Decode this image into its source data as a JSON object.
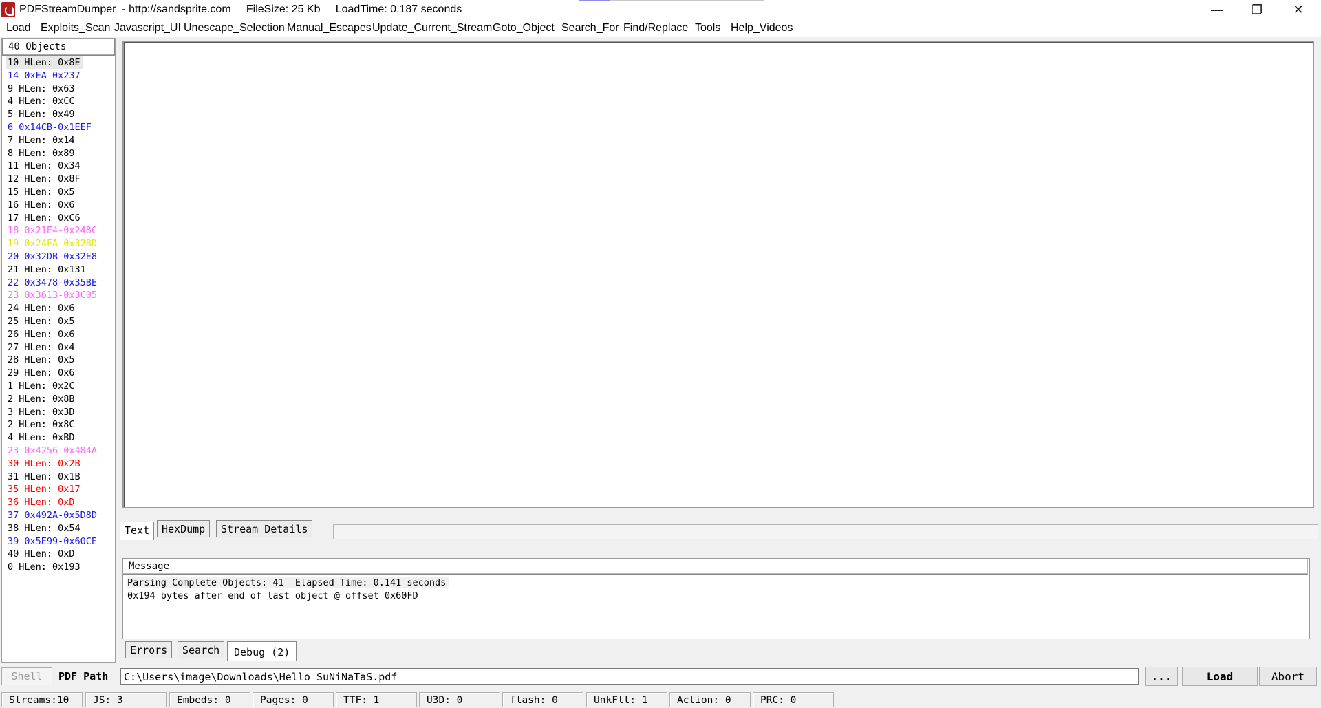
{
  "window": {
    "title": "PDFStreamDumper  - http://sandsprite.com     FileSize: 25 Kb     LoadTime: 0.187 seconds",
    "minimize_glyph": "—",
    "maximize_glyph": "❐",
    "close_glyph": "✕"
  },
  "menu": [
    "Load",
    "Exploits_Scan",
    "Javascript_UI",
    "Unescape_Selection",
    "Manual_Escapes",
    "Update_Current_Stream",
    "Goto_Object",
    "Search_For",
    "Find/Replace",
    "Tools",
    "Help_Videos"
  ],
  "objects": {
    "header": "40 Objects",
    "items": [
      {
        "text": "10 HLen: 0x8E",
        "color": "#000000"
      },
      {
        "text": "14 0xEA-0x237",
        "color": "#1a1ae6"
      },
      {
        "text": "9 HLen: 0x63",
        "color": "#000000"
      },
      {
        "text": "4 HLen: 0xCC",
        "color": "#000000"
      },
      {
        "text": "5 HLen: 0x49",
        "color": "#000000"
      },
      {
        "text": "6 0x14CB-0x1EEF",
        "color": "#1a1ae6"
      },
      {
        "text": "7 HLen: 0x14",
        "color": "#000000"
      },
      {
        "text": "8 HLen: 0x89",
        "color": "#000000"
      },
      {
        "text": "11 HLen: 0x34",
        "color": "#000000"
      },
      {
        "text": "12 HLen: 0x8F",
        "color": "#000000"
      },
      {
        "text": "15 HLen: 0x5",
        "color": "#000000"
      },
      {
        "text": "16 HLen: 0x6",
        "color": "#000000"
      },
      {
        "text": "17 HLen: 0xC6",
        "color": "#000000"
      },
      {
        "text": "18 0x21E4-0x248C",
        "color": "#ff66ff"
      },
      {
        "text": "19 0x24FA-0x328D",
        "color": "#e6e600"
      },
      {
        "text": "20 0x32DB-0x32E8",
        "color": "#1a1ae6"
      },
      {
        "text": "21 HLen: 0x131",
        "color": "#000000"
      },
      {
        "text": "22 0x3478-0x35BE",
        "color": "#1a1ae6"
      },
      {
        "text": "23 0x3613-0x3C05",
        "color": "#ff66ff"
      },
      {
        "text": "24 HLen: 0x6",
        "color": "#000000"
      },
      {
        "text": "25 HLen: 0x5",
        "color": "#000000"
      },
      {
        "text": "26 HLen: 0x6",
        "color": "#000000"
      },
      {
        "text": "27 HLen: 0x4",
        "color": "#000000"
      },
      {
        "text": "28 HLen: 0x5",
        "color": "#000000"
      },
      {
        "text": "29 HLen: 0x6",
        "color": "#000000"
      },
      {
        "text": "1 HLen: 0x2C",
        "color": "#000000"
      },
      {
        "text": "2 HLen: 0x8B",
        "color": "#000000"
      },
      {
        "text": "3 HLen: 0x3D",
        "color": "#000000"
      },
      {
        "text": "2 HLen: 0x8C",
        "color": "#000000"
      },
      {
        "text": "4 HLen: 0xBD",
        "color": "#000000"
      },
      {
        "text": "23 0x4256-0x484A",
        "color": "#ff66ff"
      },
      {
        "text": "30 HLen: 0x2B",
        "color": "#ff0000"
      },
      {
        "text": "31 HLen: 0x1B",
        "color": "#000000"
      },
      {
        "text": "35 HLen: 0x17",
        "color": "#ff0000"
      },
      {
        "text": "36 HLen: 0xD",
        "color": "#ff0000"
      },
      {
        "text": "37 0x492A-0x5D8D",
        "color": "#1a1ae6"
      },
      {
        "text": "38 HLen: 0x54",
        "color": "#000000"
      },
      {
        "text": "39 0x5E99-0x60CE",
        "color": "#1a1ae6"
      },
      {
        "text": "40 HLen: 0xD",
        "color": "#000000"
      },
      {
        "text": "0 HLen: 0x193",
        "color": "#000000"
      }
    ]
  },
  "tabs": [
    "Text",
    "HexDump",
    "Stream Details"
  ],
  "message": {
    "header": "Message",
    "lines": [
      "Parsing Complete Objects: 41  Elapsed Time: 0.141 seconds",
      "0x194 bytes after end of last object @ offset 0x60FD"
    ]
  },
  "bottom_tabs": [
    "Errors",
    "Search",
    "Debug (2)"
  ],
  "pathbar": {
    "shell_label": "Shell",
    "path_label": "PDF Path",
    "path_value": "C:\\Users\\image\\Downloads\\Hello_SuNiNaTaS.pdf",
    "browse_label": "...",
    "load_label": "Load",
    "abort_label": "Abort"
  },
  "status": [
    "Streams:10",
    "JS: 3",
    "Embeds: 0",
    "Pages: 0",
    "TTF: 1",
    "U3D: 0",
    "flash: 0",
    "UnkFlt: 1",
    "Action: 0",
    "PRC: 0"
  ]
}
